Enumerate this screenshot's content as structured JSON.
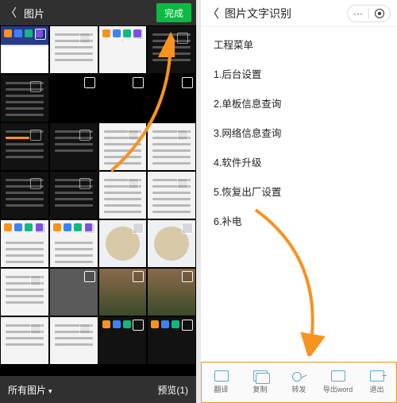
{
  "left": {
    "header": {
      "title": "图片",
      "done": "完成"
    },
    "footer": {
      "all": "所有图片",
      "preview": "预览(1)"
    }
  },
  "right": {
    "header": {
      "title": "图片文字识别"
    },
    "lines": [
      "工程菜单",
      "1.后台设置",
      "2.单板信息查询",
      "3.网络信息查询",
      "4.软件升级",
      "5.恢复出厂设置",
      "6.补电"
    ],
    "toolbar": {
      "translate": "翻译",
      "copy": "复制",
      "forward": "转发",
      "word": "导出word",
      "exit": "退出"
    }
  }
}
